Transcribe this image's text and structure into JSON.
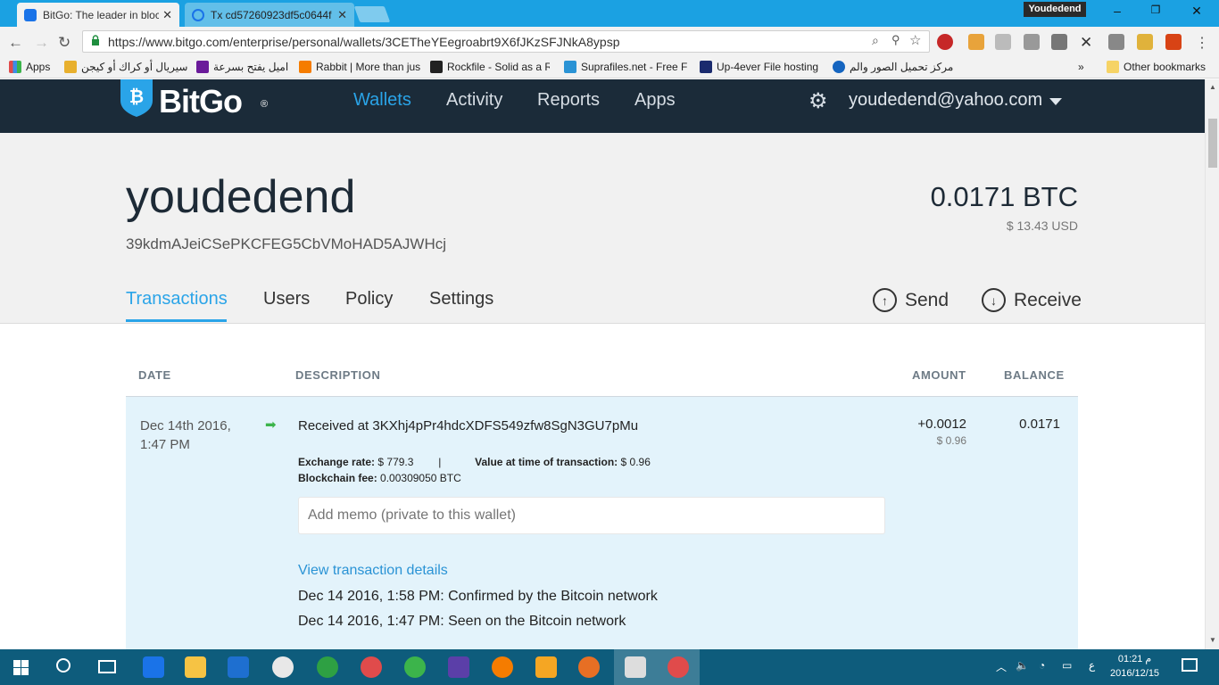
{
  "browser": {
    "tabs": [
      {
        "title": "BitGo: The leader in bloc",
        "active": true
      },
      {
        "title": "Tx cd57260923df5c0644f",
        "active": false
      }
    ],
    "profile_name": "Youdedend",
    "url": "https://www.bitgo.com/enterprise/personal/wallets/3CETheYEegroabrt9X6fJKzSFJNkA8ypsp",
    "bookmarks": [
      {
        "label": "Apps",
        "color": "#e04b4b"
      },
      {
        "label": "سيريال أو كراك أو كيجن",
        "color": "#e8b02e"
      },
      {
        "label": "اميل يفتح بسرعة",
        "color": "#6a1b9a"
      },
      {
        "label": "Rabbit | More than jus",
        "color": "#f57c00"
      },
      {
        "label": "Rockfile - Solid as a R",
        "color": "#222222"
      },
      {
        "label": "Suprafiles.net - Free F",
        "color": "#2a93d5"
      },
      {
        "label": "Up-4ever File hosting",
        "color": "#1b2b6e"
      },
      {
        "label": "مركز تحميل الصور والم",
        "color": "#1565c0"
      }
    ],
    "bookmarks_overflow": "»",
    "other_bookmarks": "Other bookmarks"
  },
  "site": {
    "logo": "BitGo",
    "logo_mark": "®",
    "nav": [
      "Wallets",
      "Activity",
      "Reports",
      "Apps"
    ],
    "active_nav": "Wallets",
    "user_email": "youdedend@yahoo.com"
  },
  "wallet": {
    "name": "youdedend",
    "address": "39kdmAJeiCSePKCFEG5CbVMoHAD5AJWHcj",
    "btc_balance": "0.0171 BTC",
    "usd_balance": "$ 13.43 USD",
    "tabs": [
      "Transactions",
      "Users",
      "Policy",
      "Settings"
    ],
    "active_tab": "Transactions",
    "send_label": "Send",
    "receive_label": "Receive"
  },
  "table": {
    "headers": {
      "date": "DATE",
      "description": "DESCRIPTION",
      "amount": "AMOUNT",
      "balance": "BALANCE"
    },
    "rows": [
      {
        "date_line1": "Dec 14th 2016,",
        "date_line2": "1:47 PM",
        "description": "Received at 3KXhj4pPr4hdcXDFS549zfw8SgN3GU7pMu",
        "exchange_rate_label": "Exchange rate:",
        "exchange_rate": "$ 779.3",
        "separator": "|",
        "value_label": "Value at time of transaction:",
        "value": "$ 0.96",
        "fee_label": "Blockchain fee:",
        "fee": "0.00309050 BTC",
        "memo_placeholder": "Add memo (private to this wallet)",
        "details_link": "View transaction details",
        "history": [
          "Dec 14 2016, 1:58 PM: Confirmed by the Bitcoin network",
          "Dec 14 2016, 1:47 PM: Seen on the Bitcoin network"
        ],
        "amount": "+0.0012",
        "amount_usd": "$ 0.96",
        "balance": "0.0171"
      }
    ]
  },
  "taskbar": {
    "time": "01:21 م",
    "date": "2016/12/15",
    "lang": "ع"
  }
}
